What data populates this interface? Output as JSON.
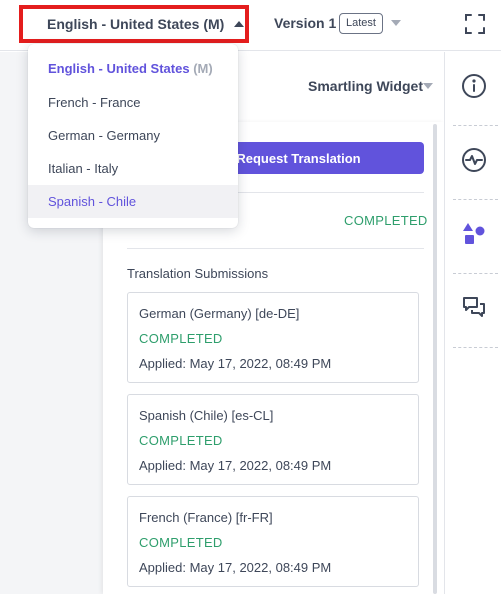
{
  "topbar": {
    "locale_label": "English - United States (M)",
    "version_label": "Version 1",
    "version_badge": "Latest"
  },
  "locale_dropdown": {
    "selected": {
      "name": "English - United States",
      "suffix": "(M)"
    },
    "options": [
      {
        "label": "French - France"
      },
      {
        "label": "German - Germany"
      },
      {
        "label": "Italian - Italy"
      },
      {
        "label": "Spanish - Chile"
      }
    ]
  },
  "widget": {
    "title": "Smartling Widget",
    "request_button": "Request Translation",
    "overall_status": "COMPLETED",
    "submissions_title": "Translation Submissions",
    "submissions": [
      {
        "locale": "German (Germany) [de-DE]",
        "status": "COMPLETED",
        "applied": "Applied: May 17, 2022, 08:49 PM"
      },
      {
        "locale": "Spanish (Chile) [es-CL]",
        "status": "COMPLETED",
        "applied": "Applied: May 17, 2022, 08:49 PM"
      },
      {
        "locale": "French (France) [fr-FR]",
        "status": "COMPLETED",
        "applied": "Applied: May 17, 2022, 08:49 PM"
      }
    ]
  },
  "rail_icons": [
    "info-icon",
    "activity-icon",
    "shapes-icon",
    "comments-icon",
    "fullscreen-icon"
  ],
  "colors": {
    "accent": "#6153dc",
    "success": "#2e9e6c",
    "highlight_border": "#e41d1d"
  }
}
